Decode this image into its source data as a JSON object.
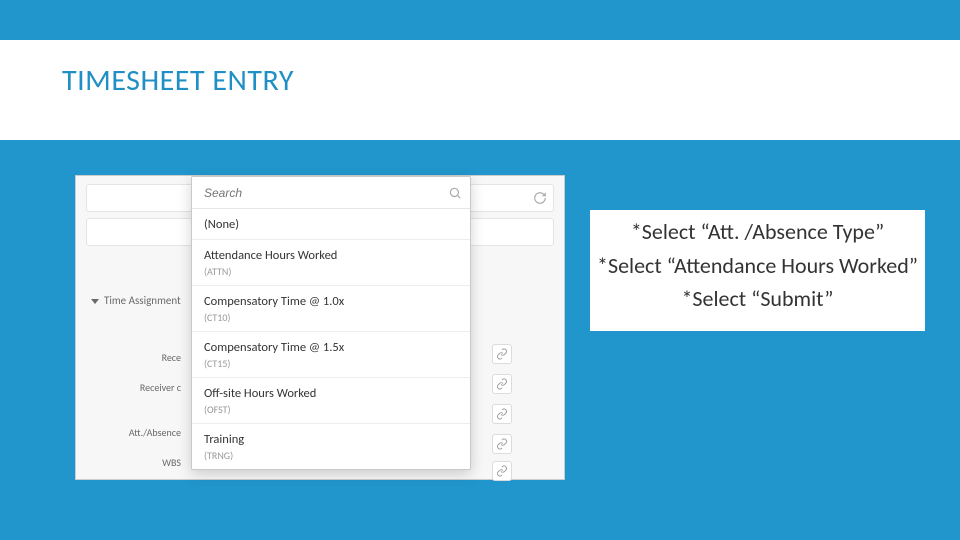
{
  "title": "TIMESHEET ENTRY",
  "instructions": {
    "line1": "*Select “Att. /Absence Type”",
    "line2": "*Select “Attendance Hours Worked”",
    "line3": "*Select “Submit”"
  },
  "screenshot": {
    "section_label": "Time Assignment",
    "field_labels": {
      "receiver1": "Rece",
      "receiver2": "Receiver c",
      "att_type": "Att./Absence",
      "wbs": "WBS"
    },
    "search_placeholder": "Search",
    "options": [
      {
        "label": "(None)",
        "code": ""
      },
      {
        "label": "Attendance Hours Worked",
        "code": "(ATTN)"
      },
      {
        "label": "Compensatory Time @ 1.0x",
        "code": "(CT10)"
      },
      {
        "label": "Compensatory Time @ 1.5x",
        "code": "(CT15)"
      },
      {
        "label": "Off-site Hours Worked",
        "code": "(OFST)"
      },
      {
        "label": "Training",
        "code": "(TRNG)"
      }
    ]
  }
}
